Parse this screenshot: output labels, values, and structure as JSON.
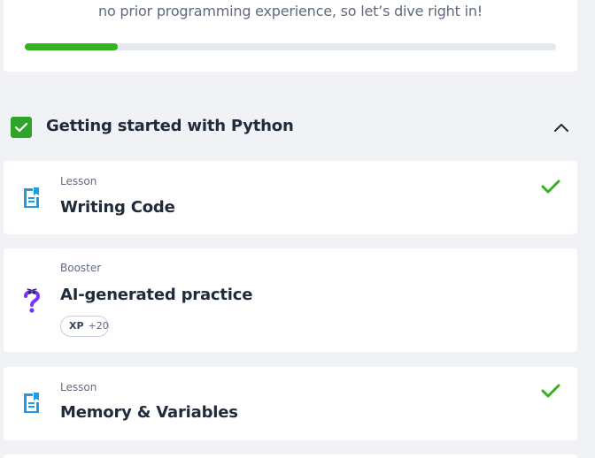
{
  "intro": {
    "text": "no prior programming experience, so let’s dive right in!",
    "progress": 0.175
  },
  "section": {
    "title": "Getting started with Python",
    "completed": true,
    "expanded": true,
    "collapse_icon": "chevron-up-icon"
  },
  "items": [
    {
      "kind": "Lesson",
      "title": "Writing Code",
      "completed": true,
      "icon": "document-icon"
    },
    {
      "kind": "Booster",
      "title": "AI-generated practice",
      "completed": false,
      "icon": "question-mark-icon",
      "xp_label": "XP",
      "xp_value": "+20"
    },
    {
      "kind": "Lesson",
      "title": "Memory & Variables",
      "completed": true,
      "icon": "document-icon"
    }
  ],
  "colors": {
    "accent_green": "#36b220",
    "lesson_icon_blue": "#1b9ce6",
    "booster_icon_purple": "#7933ff",
    "text_dark": "#1f2b3a",
    "text_muted": "#5e6a81"
  }
}
